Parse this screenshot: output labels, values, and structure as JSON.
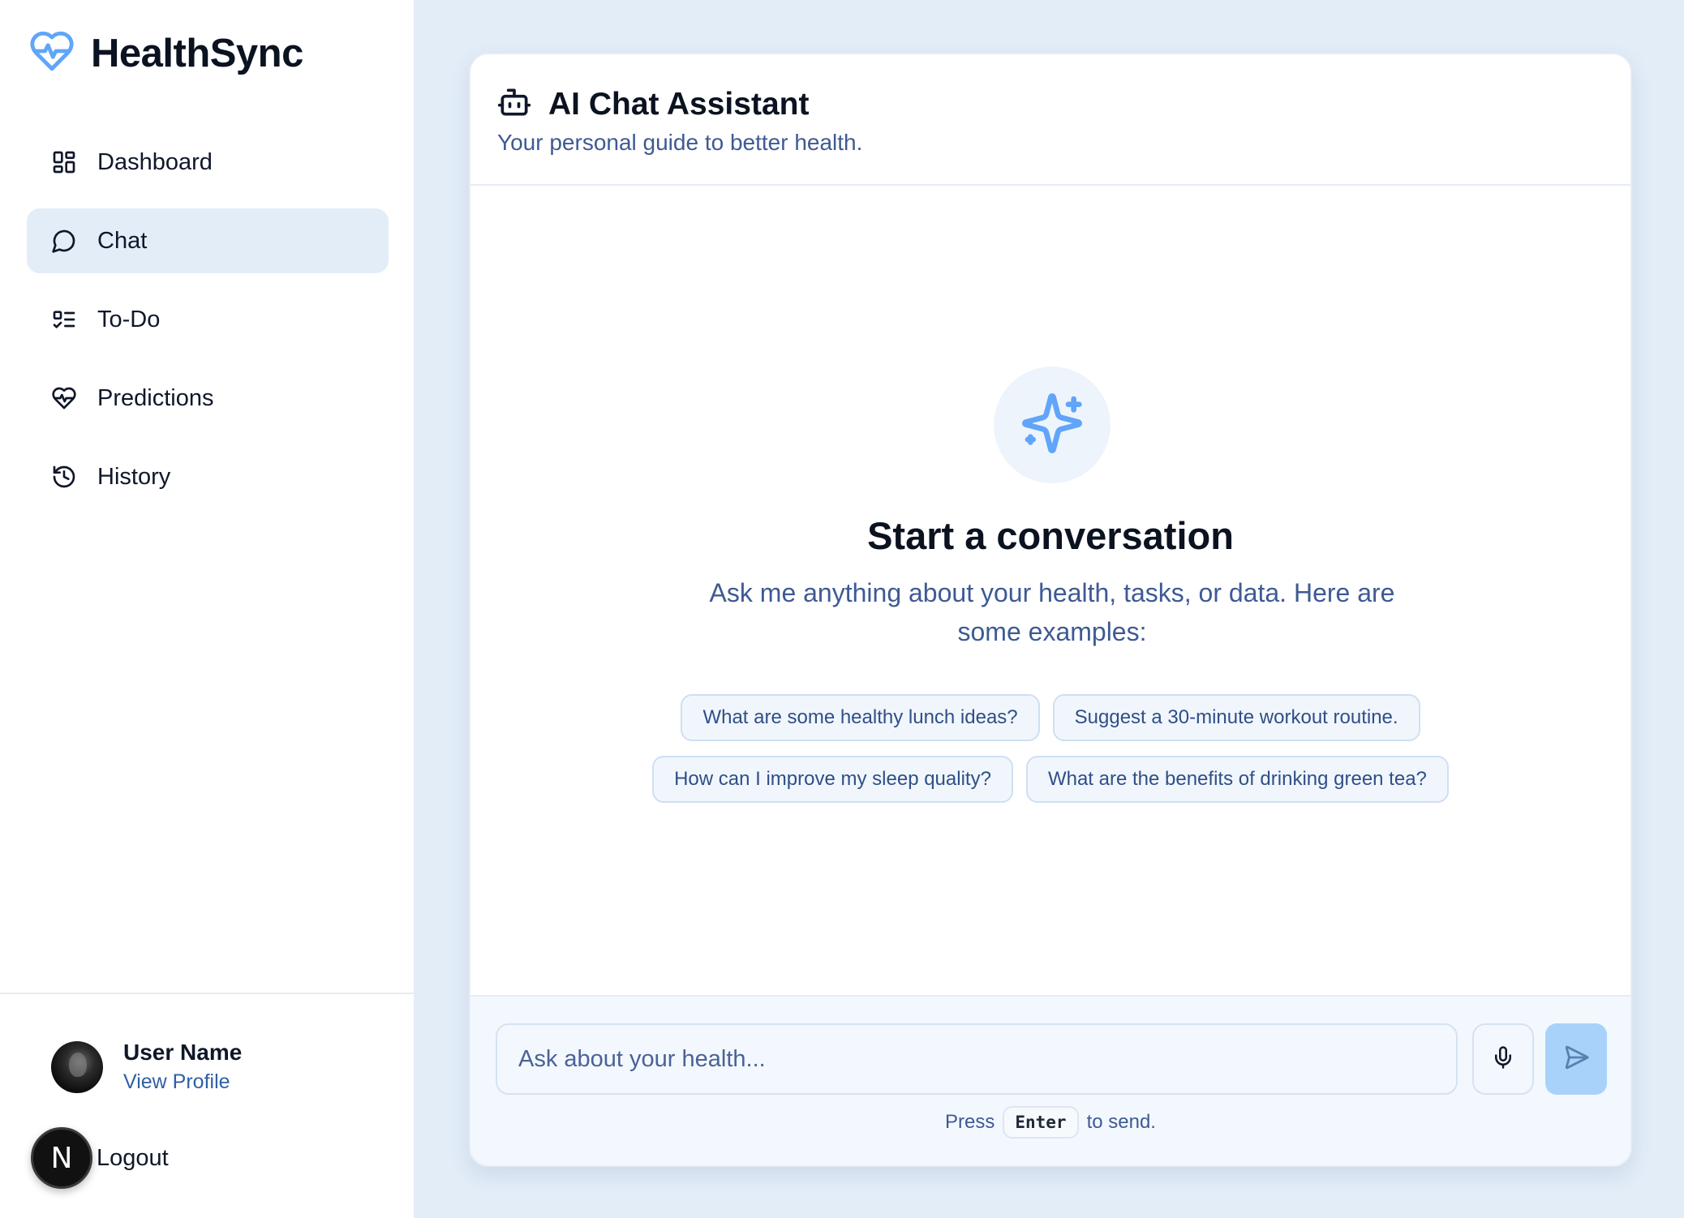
{
  "brand": {
    "name": "HealthSync",
    "icon": "heart-pulse-icon",
    "accent": "#60a5fa"
  },
  "nav": {
    "items": [
      {
        "label": "Dashboard",
        "icon": "dashboard-grid-icon",
        "active": false
      },
      {
        "label": "Chat",
        "icon": "chat-bubble-icon",
        "active": true
      },
      {
        "label": "To-Do",
        "icon": "checklist-icon",
        "active": false
      },
      {
        "label": "Predictions",
        "icon": "heart-pulse-icon",
        "active": false
      },
      {
        "label": "History",
        "icon": "history-icon",
        "active": false
      }
    ]
  },
  "user": {
    "name": "User Name",
    "profile_link": "View Profile"
  },
  "logout": {
    "badge": "N",
    "label": "Logout"
  },
  "chat": {
    "title": "AI Chat Assistant",
    "subtitle": "Your personal guide to better health.",
    "empty_title": "Start a conversation",
    "empty_description": "Ask me anything about your health, tasks, or data. Here are some examples:",
    "suggestions": [
      "What are some healthy lunch ideas?",
      "Suggest a 30-minute workout routine.",
      "How can I improve my sleep quality?",
      "What are the benefits of drinking green tea?"
    ],
    "input_placeholder": "Ask about your health...",
    "hint_prefix": "Press",
    "hint_key": "Enter",
    "hint_suffix": "to send."
  },
  "colors": {
    "page_bg": "#e3edf8",
    "active_nav_bg": "#e3edf8",
    "subtitle_text": "#3e5a94",
    "send_button": "#a9d2fa"
  }
}
